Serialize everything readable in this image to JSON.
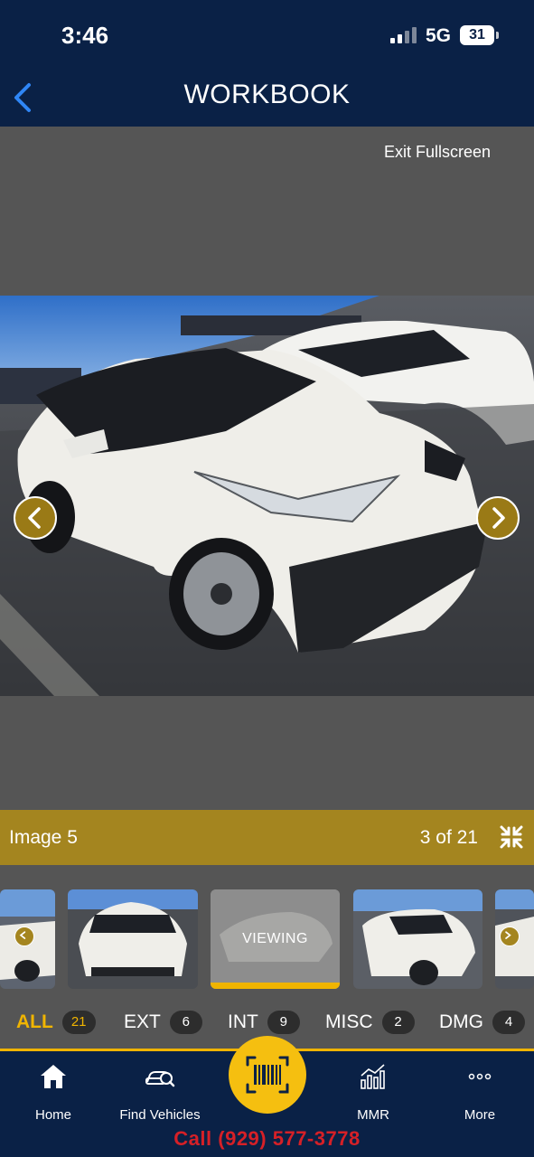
{
  "status_bar": {
    "time": "3:46",
    "network": "5G",
    "battery": "31"
  },
  "nav": {
    "title": "WORKBOOK",
    "back_icon": "chevron-left-icon"
  },
  "viewer": {
    "exit_fullscreen_label": "Exit Fullscreen",
    "image_label": "Image 5",
    "image_count": "3 of 21",
    "collapse_icon": "collapse-fullscreen-icon",
    "prev_icon": "chevron-left-icon",
    "next_icon": "chevron-right-icon"
  },
  "thumbnails": {
    "viewing_label": "VIEWING"
  },
  "categories": [
    {
      "label": "ALL",
      "count": "21",
      "active": true
    },
    {
      "label": "EXT",
      "count": "6",
      "active": false
    },
    {
      "label": "INT",
      "count": "9",
      "active": false
    },
    {
      "label": "MISC",
      "count": "2",
      "active": false
    },
    {
      "label": "DMG",
      "count": "4",
      "active": false
    }
  ],
  "tabbar": {
    "tabs": [
      {
        "label": "Home",
        "icon": "home-icon"
      },
      {
        "label": "Find Vehicles",
        "icon": "find-vehicle-icon"
      },
      {
        "label": "MMR",
        "icon": "chart-icon"
      },
      {
        "label": "More",
        "icon": "more-icon"
      }
    ],
    "scan_icon": "barcode-scan-icon"
  },
  "call_text": "Call (929) 577-3778",
  "colors": {
    "nav_bg": "#0a2146",
    "accent_gold": "#a4851f",
    "accent_yellow": "#f0b400",
    "call_red": "#d62027"
  }
}
